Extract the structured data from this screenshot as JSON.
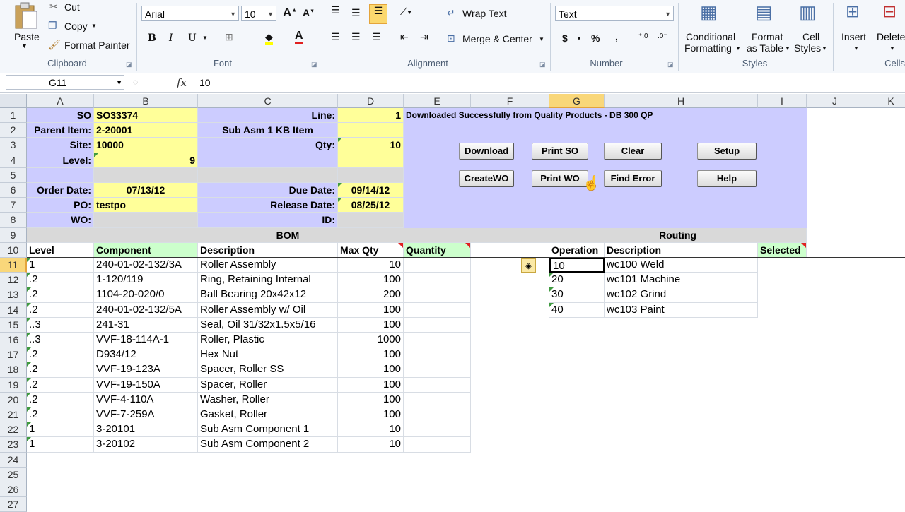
{
  "ribbon": {
    "clipboard": {
      "paste": "Paste",
      "cut": "Cut",
      "copy": "Copy",
      "format_painter": "Format Painter",
      "label": "Clipboard"
    },
    "font": {
      "name": "Arial",
      "size": "10",
      "label": "Font"
    },
    "alignment": {
      "wrap_text": "Wrap Text",
      "merge_center": "Merge & Center",
      "label": "Alignment"
    },
    "number": {
      "format": "Text",
      "currency": "$",
      "percent": "%",
      "comma": ",",
      "label": "Number"
    },
    "styles": {
      "conditional": "Conditional",
      "conditional2": "Formatting",
      "format_table": "Format",
      "format_table2": "as Table",
      "cell_styles": "Cell",
      "cell_styles2": "Styles",
      "label": "Styles"
    },
    "cells": {
      "insert": "Insert",
      "delete": "Delete",
      "label": "Cells"
    }
  },
  "formula_bar": {
    "name_box": "G11",
    "fx": "fx",
    "content": "10"
  },
  "columns": [
    "A",
    "B",
    "C",
    "D",
    "E",
    "F",
    "G",
    "H",
    "I",
    "J",
    "K"
  ],
  "rows": [
    "1",
    "2",
    "3",
    "4",
    "5",
    "6",
    "7",
    "8",
    "9",
    "10",
    "11",
    "12",
    "13",
    "14",
    "15",
    "16",
    "17",
    "18",
    "19",
    "20",
    "21",
    "22",
    "23",
    "24",
    "25",
    "26",
    "27"
  ],
  "header": {
    "so_label": "SO",
    "so": "SO33374",
    "parent_label": "Parent Item:",
    "parent": "2-20001",
    "parent_desc": "Sub Asm 1 KB Item",
    "site_label": "Site:",
    "site": "10000",
    "level_label": "Level:",
    "level": "9",
    "line_label": "Line:",
    "line": "1",
    "qty_label": "Qty:",
    "qty": "10",
    "order_date_label": "Order Date:",
    "order_date": "07/13/12",
    "due_date_label": "Due Date:",
    "due_date": "09/14/12",
    "po_label": "PO:",
    "po": "testpo",
    "release_date_label": "Release Date:",
    "release_date": "08/25/12",
    "wo_label": "WO:",
    "id_label": "ID:",
    "status": "Downloaded Successfully from Quality Products - DB 300 QP"
  },
  "buttons": {
    "download": "Download",
    "print_so": "Print SO",
    "clear": "Clear",
    "setup": "Setup",
    "create_wo": "CreateWO",
    "print_wo": "Print WO",
    "find_error": "Find Error",
    "help": "Help"
  },
  "bom": {
    "title": "BOM",
    "headers": {
      "level": "Level",
      "component": "Component",
      "description": "Description",
      "max_qty": "Max Qty",
      "quantity": "Quantity"
    },
    "rows": [
      {
        "level": "1",
        "component": "240-01-02-132/3A",
        "description": "Roller Assembly",
        "max_qty": "10"
      },
      {
        "level": ".2",
        "component": "1-120/119",
        "description": "Ring, Retaining Internal",
        "max_qty": "100"
      },
      {
        "level": ".2",
        "component": "1104-20-020/0",
        "description": "Ball Bearing 20x42x12",
        "max_qty": "200"
      },
      {
        "level": ".2",
        "component": "240-01-02-132/5A",
        "description": "Roller Assembly w/ Oil",
        "max_qty": "100"
      },
      {
        "level": "..3",
        "component": "241-31",
        "description": "Seal, Oil 31/32x1.5x5/16",
        "max_qty": "100"
      },
      {
        "level": "..3",
        "component": "VVF-18-114A-1",
        "description": "Roller, Plastic",
        "max_qty": "1000"
      },
      {
        "level": ".2",
        "component": "D934/12",
        "description": "Hex Nut",
        "max_qty": "100"
      },
      {
        "level": ".2",
        "component": "VVF-19-123A",
        "description": "Spacer, Roller SS",
        "max_qty": "100"
      },
      {
        "level": ".2",
        "component": "VVF-19-150A",
        "description": "Spacer, Roller",
        "max_qty": "100"
      },
      {
        "level": ".2",
        "component": "VVF-4-110A",
        "description": "Washer, Roller",
        "max_qty": "100"
      },
      {
        "level": ".2",
        "component": "VVF-7-259A",
        "description": "Gasket, Roller",
        "max_qty": "100"
      },
      {
        "level": "1",
        "component": "3-20101",
        "description": "Sub Asm Component 1",
        "max_qty": "10"
      },
      {
        "level": "1",
        "component": "3-20102",
        "description": "Sub Asm Component 2",
        "max_qty": "10"
      }
    ]
  },
  "routing": {
    "title": "Routing",
    "headers": {
      "operation": "Operation",
      "description": "Description",
      "selected": "Selected"
    },
    "rows": [
      {
        "operation": "10",
        "description": "wc100 Weld"
      },
      {
        "operation": "20",
        "description": "wc101 Machine"
      },
      {
        "operation": "30",
        "description": "wc102 Grind"
      },
      {
        "operation": "40",
        "description": "wc103 Paint"
      }
    ]
  },
  "colors": {
    "yellow": "#ffff99",
    "lavender": "#ccccff",
    "green": "#ccffcc",
    "gray": "#d9d9d9",
    "selected_header": "#f9d77a"
  }
}
